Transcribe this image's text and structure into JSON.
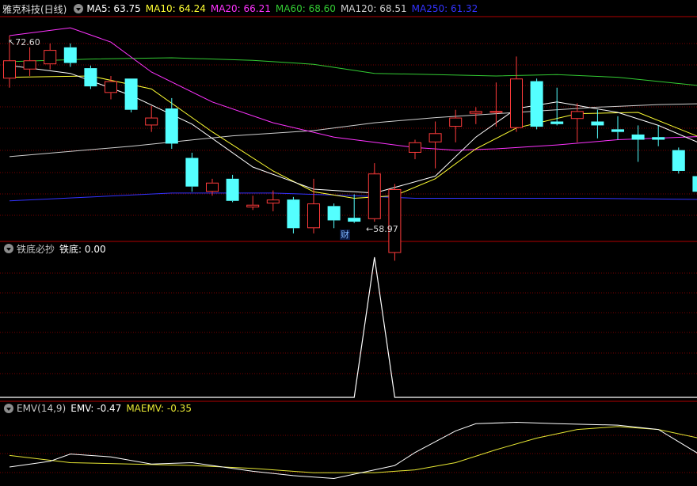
{
  "colors": {
    "bg": "#000000",
    "grid": "#7a0000",
    "separator": "#b00000",
    "up": "#ff3b3b",
    "down": "#54ffff",
    "ma5": "#ffffff",
    "ma10": "#ffff33",
    "ma20": "#ff33ff",
    "ma60": "#33cc33",
    "ma120": "#cfcfcf",
    "ma250": "#3333ff",
    "tiedi": "#ffffff",
    "emv": "#ffffff",
    "maemv": "#e6e633"
  },
  "price_panel": {
    "icon": "chevron-down-icon",
    "title": "雅克科技(日线)",
    "legend": [
      {
        "id": "ma5",
        "text": "MA5: 63.75",
        "color": "#ffffff"
      },
      {
        "id": "ma10",
        "text": "MA10: 64.24",
        "color": "#ffff33"
      },
      {
        "id": "ma20",
        "text": "MA20: 66.21",
        "color": "#ff33ff"
      },
      {
        "id": "ma60",
        "text": "MA60: 68.60",
        "color": "#33cc33"
      },
      {
        "id": "ma120",
        "text": "MA120: 68.51",
        "color": "#cfcfcf"
      },
      {
        "id": "ma250",
        "text": "MA250: 61.32",
        "color": "#3333ff"
      }
    ],
    "high_label": "72.60",
    "low_label": "58.97",
    "marker": "财"
  },
  "tiedi_panel": {
    "icon": "chevron-down-icon",
    "title": "铁底必抄",
    "legend": [
      {
        "id": "tiedi",
        "text": "铁底: 0.00",
        "color": "#ffffff"
      }
    ]
  },
  "emv_panel": {
    "icon": "chevron-down-icon",
    "title": "EMV(14,9)",
    "legend": [
      {
        "id": "emv",
        "text": "EMV: -0.47",
        "color": "#ffffff"
      },
      {
        "id": "maemv",
        "text": "MAEMV: -0.35",
        "color": "#e6e633"
      }
    ]
  },
  "chart_data": {
    "type": "candlestick",
    "price_range": [
      58.0,
      74.0
    ],
    "candles": [
      {
        "o": 69.3,
        "h": 72.6,
        "l": 68.6,
        "c": 70.7
      },
      {
        "o": 70.0,
        "h": 71.7,
        "l": 69.5,
        "c": 70.7
      },
      {
        "o": 70.4,
        "h": 72.0,
        "l": 70.0,
        "c": 71.5
      },
      {
        "o": 71.7,
        "h": 72.0,
        "l": 70.2,
        "c": 70.5
      },
      {
        "o": 70.1,
        "h": 70.3,
        "l": 68.5,
        "c": 68.7
      },
      {
        "o": 68.2,
        "h": 69.5,
        "l": 67.7,
        "c": 69.1
      },
      {
        "o": 69.3,
        "h": 69.3,
        "l": 66.7,
        "c": 66.9
      },
      {
        "o": 65.7,
        "h": 67.2,
        "l": 65.2,
        "c": 66.3
      },
      {
        "o": 67.0,
        "h": 67.8,
        "l": 63.9,
        "c": 64.3
      },
      {
        "o": 63.2,
        "h": 63.6,
        "l": 60.6,
        "c": 61.0
      },
      {
        "o": 60.6,
        "h": 61.6,
        "l": 60.3,
        "c": 61.3
      },
      {
        "o": 61.6,
        "h": 61.9,
        "l": 59.8,
        "c": 59.9
      },
      {
        "o": 59.4,
        "h": 60.3,
        "l": 59.2,
        "c": 59.6
      },
      {
        "o": 59.7,
        "h": 60.7,
        "l": 59.1,
        "c": 60.0
      },
      {
        "o": 60.0,
        "h": 60.2,
        "l": 57.4,
        "c": 57.8
      },
      {
        "o": 57.8,
        "h": 61.6,
        "l": 57.4,
        "c": 59.7
      },
      {
        "o": 59.5,
        "h": 59.7,
        "l": 57.8,
        "c": 58.4
      },
      {
        "o": 58.6,
        "h": 60.4,
        "l": 58.2,
        "c": 58.3
      },
      {
        "o": 58.5,
        "h": 62.8,
        "l": 58.3,
        "c": 62.0
      },
      {
        "o": 55.9,
        "h": 61.2,
        "l": 55.3,
        "c": 60.8
      },
      {
        "o": 63.6,
        "h": 64.6,
        "l": 63.1,
        "c": 64.4
      },
      {
        "o": 64.4,
        "h": 66.0,
        "l": 62.4,
        "c": 65.1
      },
      {
        "o": 65.6,
        "h": 66.9,
        "l": 64.4,
        "c": 66.3
      },
      {
        "o": 66.6,
        "h": 67.1,
        "l": 65.8,
        "c": 66.8
      },
      {
        "o": 66.8,
        "h": 69.0,
        "l": 65.6,
        "c": 66.8
      },
      {
        "o": 65.5,
        "h": 71.0,
        "l": 65.2,
        "c": 69.3
      },
      {
        "o": 69.1,
        "h": 69.3,
        "l": 65.4,
        "c": 65.6
      },
      {
        "o": 66.0,
        "h": 68.6,
        "l": 65.7,
        "c": 65.8
      },
      {
        "o": 66.2,
        "h": 67.4,
        "l": 64.4,
        "c": 66.8
      },
      {
        "o": 66.0,
        "h": 66.9,
        "l": 64.7,
        "c": 65.7
      },
      {
        "o": 65.4,
        "h": 66.4,
        "l": 64.6,
        "c": 65.2
      },
      {
        "o": 65.0,
        "h": 65.7,
        "l": 62.9,
        "c": 64.6
      },
      {
        "o": 64.8,
        "h": 65.7,
        "l": 64.1,
        "c": 64.6
      },
      {
        "o": 63.8,
        "h": 64.0,
        "l": 62.0,
        "c": 62.2
      },
      {
        "o": 61.8,
        "h": 61.9,
        "l": 60.0,
        "c": 60.6
      },
      {
        "o": 60.1,
        "h": 60.6,
        "l": 59.4,
        "c": 59.6
      }
    ],
    "ma": {
      "ma5": [
        [
          0,
          70.3
        ],
        [
          3,
          69.7
        ],
        [
          6,
          68.0
        ],
        [
          9,
          65.8
        ],
        [
          12,
          62.5
        ],
        [
          15,
          60.8
        ],
        [
          18,
          60.5
        ],
        [
          21,
          61.8
        ],
        [
          23,
          64.8
        ],
        [
          25,
          67.0
        ],
        [
          27,
          67.5
        ],
        [
          30,
          66.7
        ],
        [
          32,
          65.7
        ],
        [
          35,
          63.7
        ]
      ],
      "ma10": [
        [
          0,
          69.4
        ],
        [
          4,
          69.5
        ],
        [
          7,
          68.5
        ],
        [
          10,
          65.2
        ],
        [
          13,
          62.2
        ],
        [
          15,
          60.6
        ],
        [
          17,
          60.1
        ],
        [
          19,
          60.3
        ],
        [
          21,
          61.6
        ],
        [
          23,
          63.9
        ],
        [
          25,
          65.5
        ],
        [
          28,
          66.6
        ],
        [
          31,
          66.7
        ],
        [
          35,
          64.2
        ]
      ],
      "ma20": [
        [
          0,
          72.6
        ],
        [
          3,
          73.2
        ],
        [
          5,
          72.1
        ],
        [
          7,
          69.8
        ],
        [
          10,
          67.5
        ],
        [
          13,
          65.9
        ],
        [
          16,
          64.8
        ],
        [
          18,
          64.4
        ],
        [
          20,
          64.0
        ],
        [
          22,
          63.8
        ],
        [
          24,
          63.9
        ],
        [
          27,
          64.2
        ],
        [
          30,
          64.6
        ],
        [
          35,
          64.9
        ]
      ],
      "ma60": [
        [
          0,
          70.6
        ],
        [
          4,
          70.8
        ],
        [
          8,
          70.9
        ],
        [
          12,
          70.7
        ],
        [
          15,
          70.4
        ],
        [
          18,
          69.7
        ],
        [
          21,
          69.6
        ],
        [
          24,
          69.5
        ],
        [
          27,
          69.6
        ],
        [
          30,
          69.4
        ],
        [
          35,
          68.6
        ]
      ],
      "ma120": [
        [
          0,
          63.3
        ],
        [
          6,
          64.1
        ],
        [
          11,
          64.9
        ],
        [
          15,
          65.3
        ],
        [
          18,
          65.9
        ],
        [
          21,
          66.3
        ],
        [
          25,
          66.7
        ],
        [
          29,
          67.1
        ],
        [
          32,
          67.3
        ],
        [
          35,
          67.4
        ]
      ],
      "ma250": [
        [
          0,
          59.9
        ],
        [
          8,
          60.5
        ],
        [
          13,
          60.5
        ],
        [
          17,
          60.3
        ],
        [
          20,
          60.1
        ],
        [
          24,
          60.1
        ],
        [
          28,
          60.1
        ],
        [
          35,
          60.0
        ]
      ]
    },
    "tiedi": {
      "values_range": [
        0,
        1
      ],
      "spike_index": 18,
      "spike_value": 1.0
    },
    "emv": {
      "emv": [
        [
          0,
          -0.7
        ],
        [
          2,
          -0.3
        ],
        [
          3,
          0.2
        ],
        [
          5,
          0.0
        ],
        [
          7,
          -0.5
        ],
        [
          9,
          -0.4
        ],
        [
          12,
          -1.0
        ],
        [
          14,
          -1.3
        ],
        [
          16,
          -1.5
        ],
        [
          18,
          -0.9
        ],
        [
          19,
          -0.6
        ],
        [
          20,
          0.3
        ],
        [
          22,
          1.8
        ],
        [
          23,
          2.3
        ],
        [
          25,
          2.4
        ],
        [
          27,
          2.3
        ],
        [
          30,
          2.2
        ],
        [
          32,
          1.9
        ],
        [
          34,
          0.2
        ],
        [
          35,
          -0.5
        ]
      ],
      "maemv": [
        [
          0,
          0.1
        ],
        [
          3,
          -0.4
        ],
        [
          6,
          -0.5
        ],
        [
          9,
          -0.6
        ],
        [
          12,
          -0.8
        ],
        [
          15,
          -1.1
        ],
        [
          18,
          -1.1
        ],
        [
          20,
          -0.9
        ],
        [
          22,
          -0.4
        ],
        [
          24,
          0.5
        ],
        [
          26,
          1.3
        ],
        [
          28,
          1.9
        ],
        [
          30,
          2.1
        ],
        [
          32,
          1.9
        ],
        [
          35,
          1.0
        ]
      ],
      "range": [
        -1.8,
        2.7
      ]
    }
  }
}
